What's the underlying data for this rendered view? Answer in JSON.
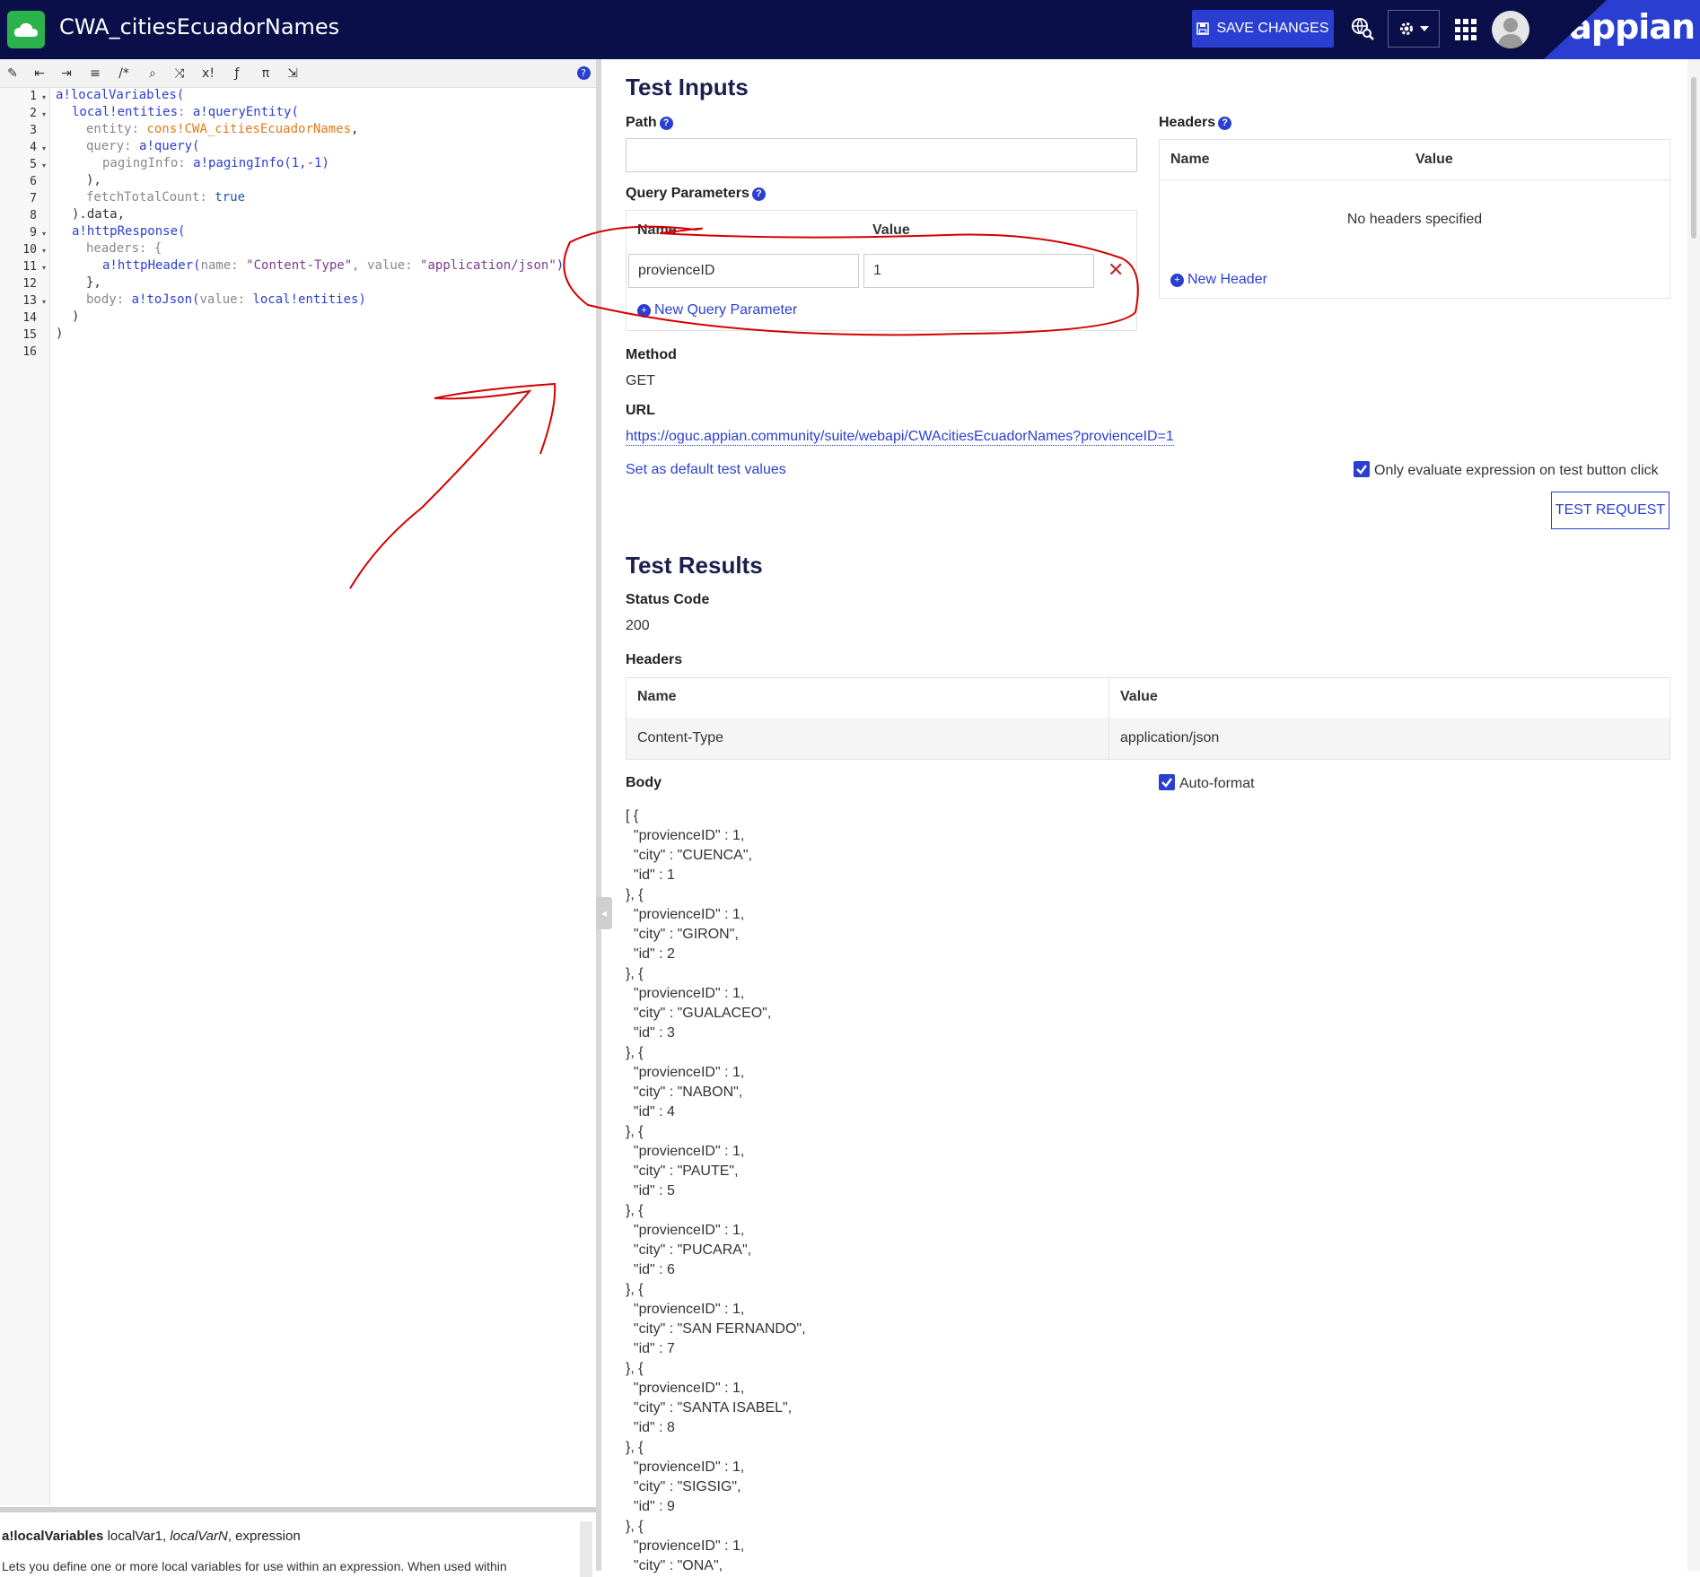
{
  "app": {
    "title": "CWA_citiesEcuadorNames",
    "brand": "appian"
  },
  "topbar": {
    "save_label": "SAVE CHANGES"
  },
  "editor": {
    "line_numbers": [
      "1",
      "2",
      "3",
      "4",
      "5",
      "6",
      "7",
      "8",
      "9",
      "10",
      "11",
      "12",
      "13",
      "14",
      "15",
      "16"
    ],
    "code": {
      "l1": "a!localVariables(",
      "l2a": "local!entities",
      "l2b": ": ",
      "l2c": "a!queryEntity(",
      "l3a": "entity",
      "l3b": ": ",
      "l3c": "cons!CWA_citiesEcuadorNames",
      "l3d": ",",
      "l4a": "query",
      "l4b": ": ",
      "l4c": "a!query(",
      "l5a": "pagingInfo",
      "l5b": ": ",
      "l5c": "a!pagingInfo(1,-1)",
      "l6": "),",
      "l7a": "fetchTotalCount",
      "l7b": ": ",
      "l7c": "true",
      "l8": ").data,",
      "l9": "a!httpResponse(",
      "l10a": "headers",
      "l10b": ": {",
      "l11a": "a!httpHeader(",
      "l11b": "name",
      "l11c": ": ",
      "l11d": "\"Content-Type\"",
      "l11e": ", ",
      "l11f": "value",
      "l11g": ": ",
      "l11h": "\"application/json\"",
      "l11i": ")",
      "l12": "},",
      "l13a": "body",
      "l13b": ": ",
      "l13c": "a!toJson(",
      "l13d": "value",
      "l13e": ": ",
      "l13f": "local!entities",
      "l13g": ")",
      "l14": ")",
      "l15": ")"
    },
    "docs": {
      "fn": "a!localVariables",
      "args_plain": "localVar1, ",
      "args_italic": "localVarN",
      "args_tail": ", expression",
      "description": "Lets you define one or more local variables for use within an expression. When used within"
    }
  },
  "test_inputs": {
    "title": "Test Inputs",
    "path_label": "Path",
    "path_value": "",
    "query_label": "Query Parameters",
    "query_cols": [
      "Name",
      "Value"
    ],
    "query_rows": [
      {
        "name": "provienceID",
        "value": "1"
      }
    ],
    "new_query": "New Query Parameter",
    "headers_label": "Headers",
    "headers_cols": [
      "Name",
      "Value"
    ],
    "headers_empty": "No headers specified",
    "new_header": "New Header",
    "method_label": "Method",
    "method_value": "GET",
    "url_label": "URL",
    "url_value": "https://oguc.appian.community/suite/webapi/CWAcitiesEcuadorNames?provienceID=1",
    "set_default": "Set as default test values",
    "only_eval": "Only evaluate expression on test button click",
    "test_btn": "TEST REQUEST"
  },
  "test_results": {
    "title": "Test Results",
    "status_label": "Status Code",
    "status_value": "200",
    "headers_label": "Headers",
    "headers_cols": [
      "Name",
      "Value"
    ],
    "headers_rows": [
      {
        "name": "Content-Type",
        "value": "application/json"
      }
    ],
    "body_label": "Body",
    "auto_format": "Auto-format",
    "body_lines": [
      "[ {",
      "  \"provienceID\" : 1,",
      "  \"city\" : \"CUENCA\",",
      "  \"id\" : 1",
      "}, {",
      "  \"provienceID\" : 1,",
      "  \"city\" : \"GIRON\",",
      "  \"id\" : 2",
      "}, {",
      "  \"provienceID\" : 1,",
      "  \"city\" : \"GUALACEO\",",
      "  \"id\" : 3",
      "}, {",
      "  \"provienceID\" : 1,",
      "  \"city\" : \"NABON\",",
      "  \"id\" : 4",
      "}, {",
      "  \"provienceID\" : 1,",
      "  \"city\" : \"PAUTE\",",
      "  \"id\" : 5",
      "}, {",
      "  \"provienceID\" : 1,",
      "  \"city\" : \"PUCARA\",",
      "  \"id\" : 6",
      "}, {",
      "  \"provienceID\" : 1,",
      "  \"city\" : \"SAN FERNANDO\",",
      "  \"id\" : 7",
      "}, {",
      "  \"provienceID\" : 1,",
      "  \"city\" : \"SANTA ISABEL\",",
      "  \"id\" : 8",
      "}, {",
      "  \"provienceID\" : 1,",
      "  \"city\" : \"SIGSIG\",",
      "  \"id\" : 9",
      "}, {",
      "  \"provienceID\" : 1,",
      "  \"city\" : \"ONA\","
    ]
  },
  "annotation_color": "#d40000",
  "accent_color": "#2a3fd1"
}
